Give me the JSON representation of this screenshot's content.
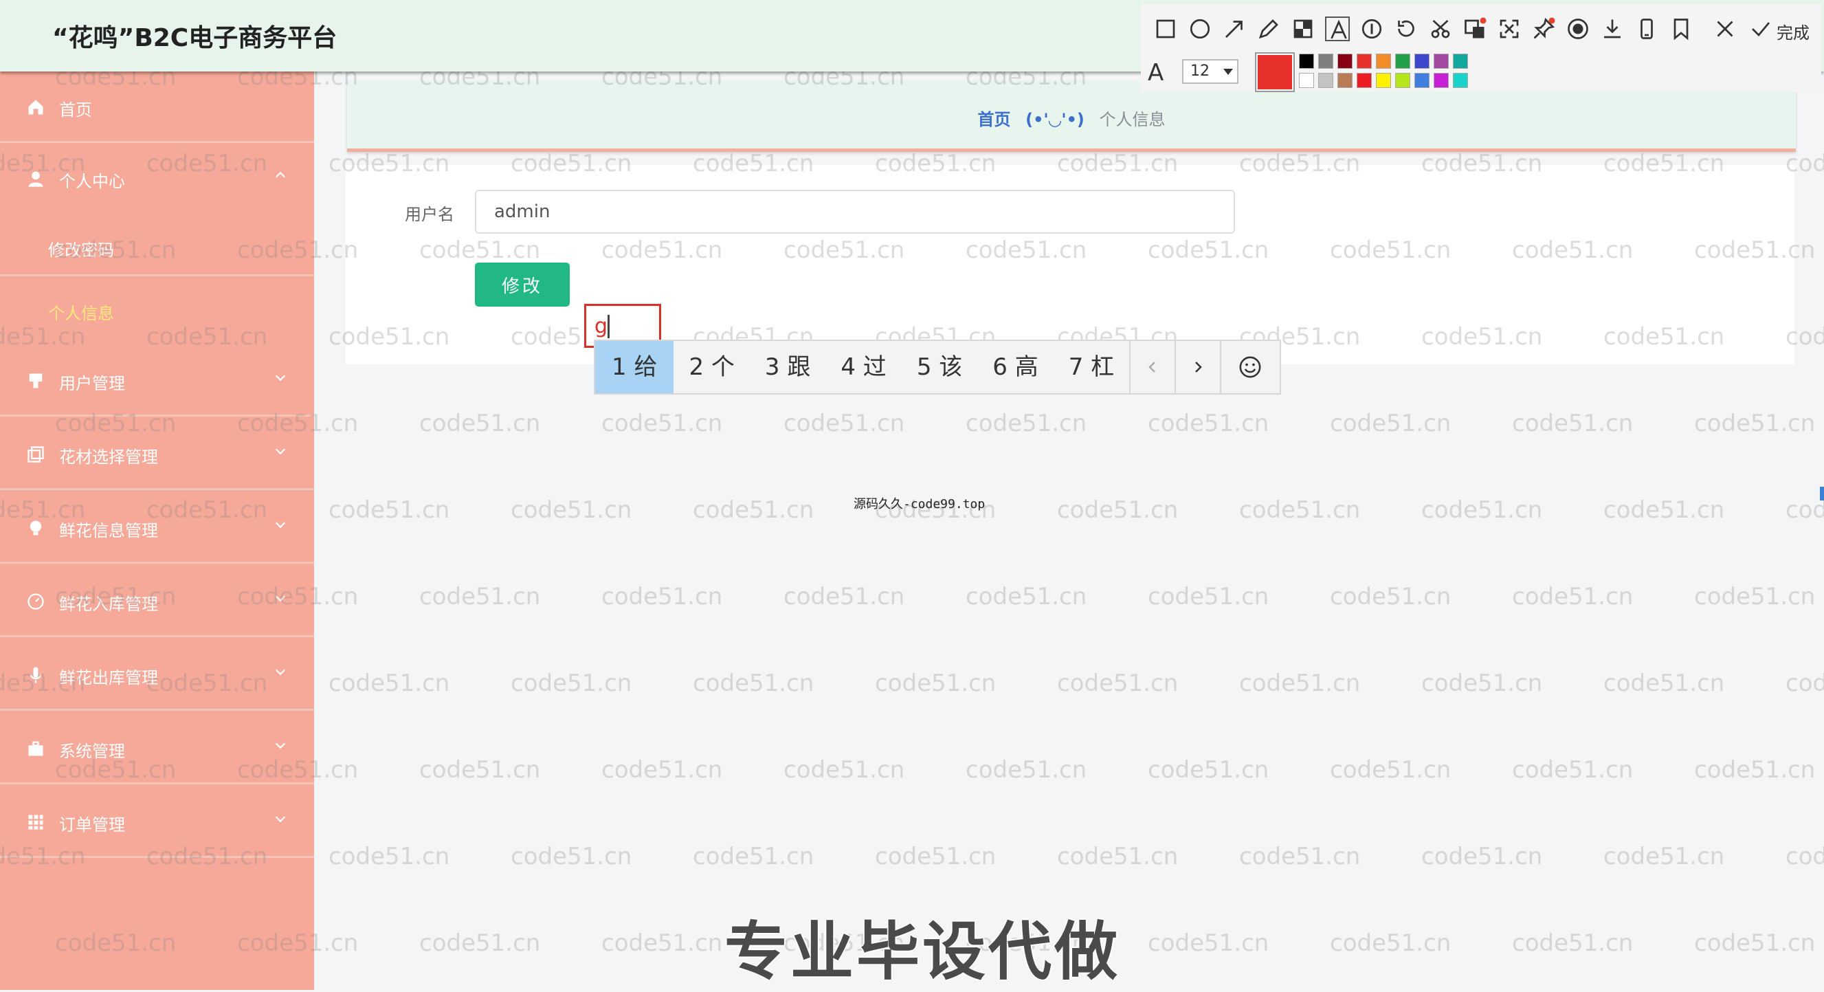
{
  "header": {
    "title": "“花鸣”B2C电子商务平台"
  },
  "sidebar": {
    "items": [
      {
        "label": "首页",
        "icon": "home-icon"
      },
      {
        "label": "个人中心",
        "icon": "user-icon",
        "expanded": true,
        "children": [
          {
            "label": "修改密码"
          },
          {
            "label": "个人信息",
            "active": true
          }
        ]
      },
      {
        "label": "用户管理",
        "icon": "users-icon"
      },
      {
        "label": "花材选择管理",
        "icon": "copy-icon"
      },
      {
        "label": "鲜花信息管理",
        "icon": "bulb-icon"
      },
      {
        "label": "鲜花入库管理",
        "icon": "gauge-icon"
      },
      {
        "label": "鲜花出库管理",
        "icon": "mic-icon"
      },
      {
        "label": "系统管理",
        "icon": "briefcase-icon"
      },
      {
        "label": "订单管理",
        "icon": "grid-icon"
      }
    ]
  },
  "breadcrumb": {
    "home": "首页",
    "separator": "(•'◡'•)",
    "current": "个人信息"
  },
  "form": {
    "username_label": "用户名",
    "username_value": "admin",
    "submit_label": "修改"
  },
  "annotation": {
    "typed_text": "g",
    "font_size": "12",
    "current_color": "#e8312c",
    "done_label": "完成",
    "palette_top": [
      "#000000",
      "#7f7f7f",
      "#880015",
      "#e8312c",
      "#f28c28",
      "#22a04b",
      "#3f48cc",
      "#a349a4",
      "#13a89e"
    ],
    "palette_bottom": [
      "#ffffff",
      "#c3c3c3",
      "#b97a57",
      "#ed1c24",
      "#fff200",
      "#b5e61d",
      "#3f7fe0",
      "#c81fd6",
      "#17d3c8"
    ]
  },
  "ime": {
    "candidates": [
      "1 给",
      "2 个",
      "3 跟",
      "4 过",
      "5 该",
      "6 高",
      "7 杠"
    ]
  },
  "overlay": {
    "watermark": "code51.cn",
    "small_watermark": "源码久久-code99.top",
    "banner": "专业毕设代做"
  }
}
